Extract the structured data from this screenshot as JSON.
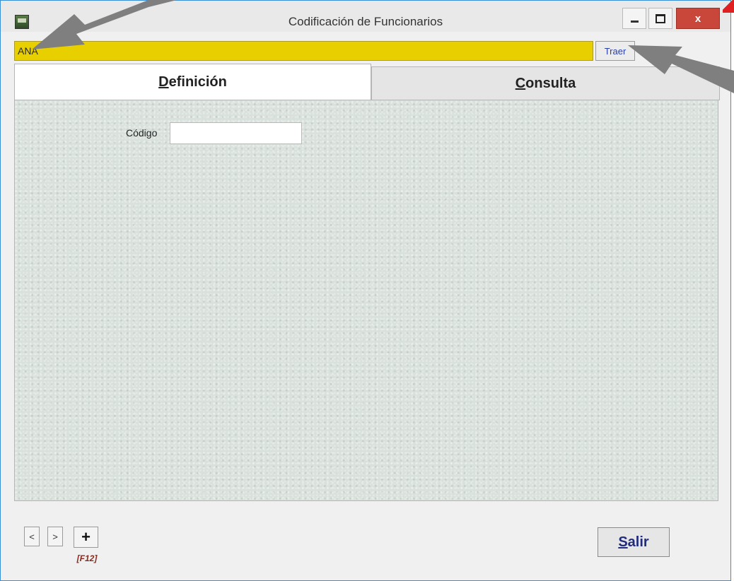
{
  "window": {
    "title": "Codificación de Funcionarios",
    "close_glyph": "x"
  },
  "search": {
    "value": "ANA",
    "button_label": "Traer"
  },
  "tabs": [
    {
      "label_underlined": "D",
      "label_rest": "efinición",
      "active": true
    },
    {
      "label_underlined": "C",
      "label_rest": "onsulta",
      "active": false
    }
  ],
  "form": {
    "codigo_label": "Código",
    "codigo_value": ""
  },
  "footer": {
    "prev_label": "<",
    "next_label": ">",
    "add_label": "+",
    "add_shortcut": "[F12]",
    "exit_underlined": "S",
    "exit_rest": "alir"
  },
  "colors": {
    "search_bg": "#e8cf00",
    "close_bg": "#c9473a",
    "annotation_arrow": "#7f7f7f",
    "panel_bg": "#d9e1dc"
  },
  "icons": {
    "app": "app-icon",
    "minimize": "minimize-icon",
    "maximize": "maximize-icon",
    "close": "close-icon"
  }
}
